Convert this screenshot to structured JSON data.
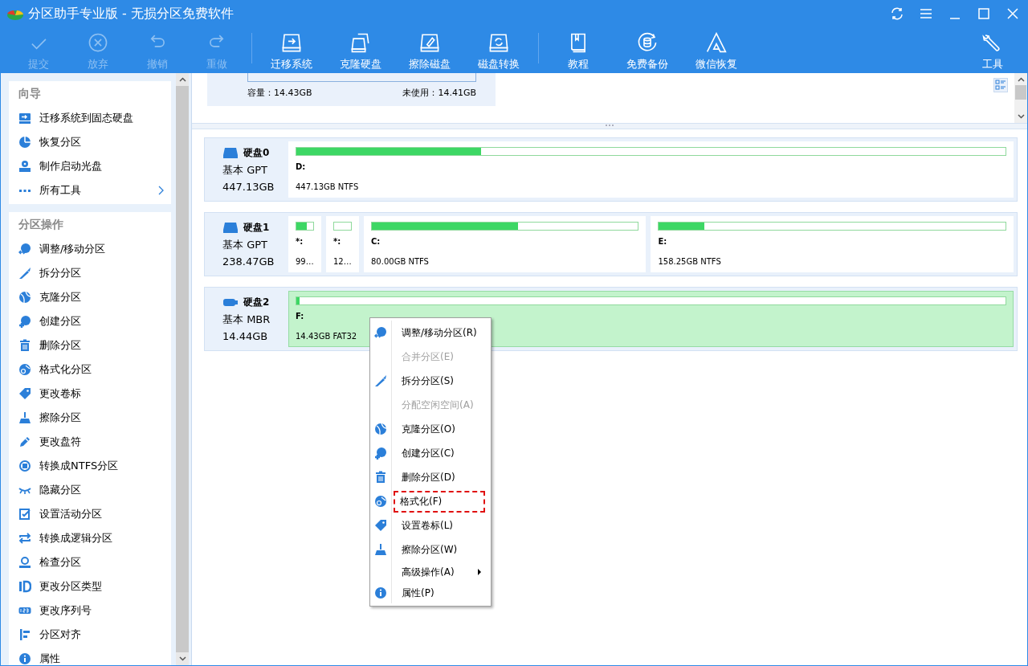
{
  "window": {
    "title": "分区助手专业版 - 无损分区免费软件"
  },
  "toolbar": [
    {
      "label": "提交",
      "disabled": true
    },
    {
      "label": "放弃",
      "disabled": true
    },
    {
      "label": "撤销",
      "disabled": true
    },
    {
      "label": "重做",
      "disabled": true
    },
    {
      "label": "迁移系统",
      "disabled": false
    },
    {
      "label": "克隆硬盘",
      "disabled": false
    },
    {
      "label": "擦除磁盘",
      "disabled": false
    },
    {
      "label": "磁盘转换",
      "disabled": false
    },
    {
      "label": "教程",
      "disabled": false
    },
    {
      "label": "免费备份",
      "disabled": false
    },
    {
      "label": "微信恢复",
      "disabled": false
    },
    {
      "label": "工具",
      "disabled": false
    }
  ],
  "sidebar": {
    "sections": [
      {
        "title": "向导",
        "items": [
          {
            "label": "迁移系统到固态硬盘",
            "has_submenu": false
          },
          {
            "label": "恢复分区",
            "has_submenu": false
          },
          {
            "label": "制作启动光盘",
            "has_submenu": false
          },
          {
            "label": "所有工具",
            "has_submenu": true
          }
        ]
      },
      {
        "title": "分区操作",
        "items": [
          {
            "label": "调整/移动分区",
            "has_submenu": false
          },
          {
            "label": "拆分分区",
            "has_submenu": false
          },
          {
            "label": "克隆分区",
            "has_submenu": false
          },
          {
            "label": "创建分区",
            "has_submenu": false
          },
          {
            "label": "删除分区",
            "has_submenu": false
          },
          {
            "label": "格式化分区",
            "has_submenu": false
          },
          {
            "label": "更改卷标",
            "has_submenu": false
          },
          {
            "label": "擦除分区",
            "has_submenu": false
          },
          {
            "label": "更改盘符",
            "has_submenu": false
          },
          {
            "label": "转换成NTFS分区",
            "has_submenu": false
          },
          {
            "label": "隐藏分区",
            "has_submenu": false
          },
          {
            "label": "设置活动分区",
            "has_submenu": false
          },
          {
            "label": "转换成逻辑分区",
            "has_submenu": false
          },
          {
            "label": "检查分区",
            "has_submenu": false
          },
          {
            "label": "更改分区类型",
            "has_submenu": false
          },
          {
            "label": "更改序列号",
            "has_submenu": false
          },
          {
            "label": "分区对齐",
            "has_submenu": false
          },
          {
            "label": "属性",
            "has_submenu": false
          }
        ]
      }
    ]
  },
  "summary": {
    "capacity": "容量：14.43GB",
    "unused": "未使用：14.41GB"
  },
  "disks": [
    {
      "name": "硬盘0",
      "kind": "hdd",
      "type": "基本 GPT",
      "size": "447.13GB",
      "partitions": [
        {
          "label": "D:",
          "info": "447.13GB NTFS",
          "level": 0.26,
          "selected": false
        }
      ]
    },
    {
      "name": "硬盘1",
      "kind": "hdd",
      "type": "基本 GPT",
      "size": "238.47GB",
      "partitions": [
        {
          "label": "*:",
          "info": "99…",
          "level": 0.6,
          "selected": false
        },
        {
          "label": "*:",
          "info": "12…",
          "level": 0,
          "selected": false
        },
        {
          "label": "C:",
          "info": "80.00GB NTFS",
          "level": 0.55,
          "selected": false
        },
        {
          "label": "E:",
          "info": "158.25GB NTFS",
          "level": 0.13,
          "selected": false
        }
      ]
    },
    {
      "name": "硬盘2",
      "kind": "usb",
      "type": "基本 MBR",
      "size": "14.44GB",
      "partitions": [
        {
          "label": "F:",
          "info": "14.43GB FAT32",
          "level": 0.004,
          "selected": true
        }
      ]
    }
  ],
  "context_menu": [
    {
      "label": "调整/移动分区(R)",
      "disabled": false,
      "has_submenu": false,
      "highlighted": false
    },
    {
      "label": "合并分区(E)",
      "disabled": true,
      "has_submenu": false,
      "highlighted": false
    },
    {
      "label": "拆分分区(S)",
      "disabled": false,
      "has_submenu": false,
      "highlighted": false
    },
    {
      "label": "分配空闲空间(A)",
      "disabled": true,
      "has_submenu": false,
      "highlighted": false
    },
    {
      "label": "克隆分区(O)",
      "disabled": false,
      "has_submenu": false,
      "highlighted": false
    },
    {
      "label": "创建分区(C)",
      "disabled": false,
      "has_submenu": false,
      "highlighted": false
    },
    {
      "label": "删除分区(D)",
      "disabled": false,
      "has_submenu": false,
      "highlighted": false
    },
    {
      "label": "格式化(F)",
      "disabled": false,
      "has_submenu": false,
      "highlighted": true
    },
    {
      "label": "设置卷标(L)",
      "disabled": false,
      "has_submenu": false,
      "highlighted": false
    },
    {
      "label": "擦除分区(W)",
      "disabled": false,
      "has_submenu": false,
      "highlighted": false
    },
    {
      "label": "高级操作(A)",
      "disabled": false,
      "has_submenu": true,
      "highlighted": false
    },
    {
      "label": "属性(P)",
      "disabled": false,
      "has_submenu": false,
      "highlighted": false
    }
  ]
}
